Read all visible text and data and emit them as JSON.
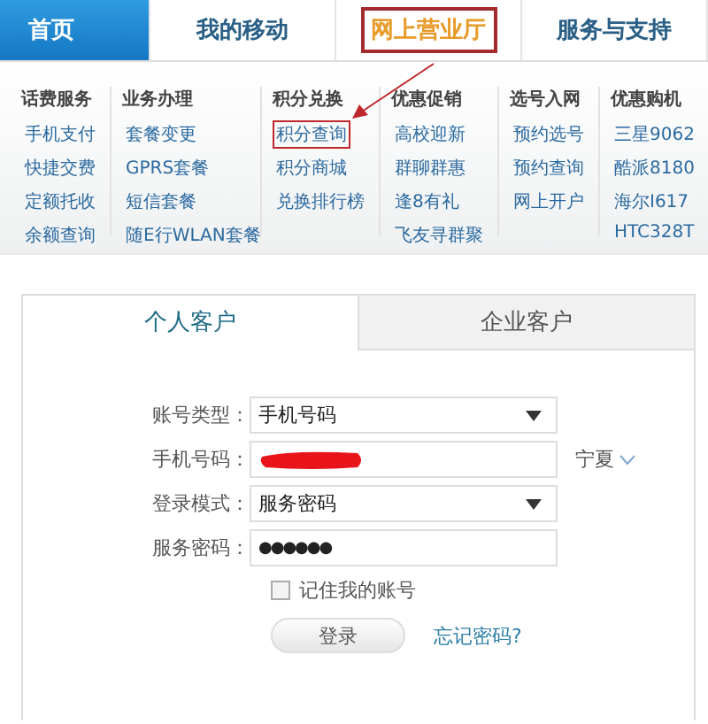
{
  "nav": {
    "tabs": [
      {
        "label": "首页",
        "selected": true,
        "highlighted": false
      },
      {
        "label": "我的移动",
        "selected": false,
        "highlighted": false
      },
      {
        "label": "网上营业厅",
        "selected": false,
        "highlighted": true
      },
      {
        "label": "服务与支持",
        "selected": false,
        "highlighted": false
      }
    ]
  },
  "menu": {
    "columns": [
      {
        "heading": "话费服务",
        "items": [
          {
            "label": "手机支付",
            "highlighted": false
          },
          {
            "label": "快捷交费",
            "highlighted": false
          },
          {
            "label": "定额托收",
            "highlighted": false
          },
          {
            "label": "余额查询",
            "highlighted": false
          }
        ]
      },
      {
        "heading": "业务办理",
        "items": [
          {
            "label": "套餐变更",
            "highlighted": false
          },
          {
            "label": "GPRS套餐",
            "highlighted": false
          },
          {
            "label": "短信套餐",
            "highlighted": false
          },
          {
            "label": "随E行WLAN套餐",
            "highlighted": false
          }
        ]
      },
      {
        "heading": "积分兑换",
        "items": [
          {
            "label": "积分查询",
            "highlighted": true
          },
          {
            "label": "积分商城",
            "highlighted": false
          },
          {
            "label": "兑换排行榜",
            "highlighted": false
          }
        ]
      },
      {
        "heading": "优惠促销",
        "items": [
          {
            "label": "高校迎新",
            "highlighted": false
          },
          {
            "label": "群聊群惠",
            "highlighted": false
          },
          {
            "label": "逢8有礼",
            "highlighted": false
          },
          {
            "label": "飞友寻群聚",
            "highlighted": false
          }
        ]
      },
      {
        "heading": "选号入网",
        "items": [
          {
            "label": "预约选号",
            "highlighted": false
          },
          {
            "label": "预约查询",
            "highlighted": false
          },
          {
            "label": "网上开户",
            "highlighted": false
          }
        ]
      },
      {
        "heading": "优惠购机",
        "items": [
          {
            "label": "三星9062",
            "highlighted": false
          },
          {
            "label": "酷派8180",
            "highlighted": false
          },
          {
            "label": "海尔I617",
            "highlighted": false
          },
          {
            "label": "HTC328T",
            "highlighted": false
          }
        ]
      }
    ]
  },
  "login": {
    "tabs": [
      {
        "label": "个人客户",
        "selected": true
      },
      {
        "label": "企业客户",
        "selected": false
      }
    ],
    "fields": [
      {
        "kind": "select",
        "label": "账号类型：",
        "value": "手机号码"
      },
      {
        "kind": "redacted",
        "label": "手机号码：",
        "side": "宁夏"
      },
      {
        "kind": "select",
        "label": "登录模式：",
        "value": "服务密码"
      },
      {
        "kind": "password",
        "label": "服务密码：",
        "value": "●●●●●●"
      }
    ],
    "remember": {
      "label": "记住我的账号",
      "checked": false
    },
    "submit": "登录",
    "forgot": "忘记密码?"
  }
}
